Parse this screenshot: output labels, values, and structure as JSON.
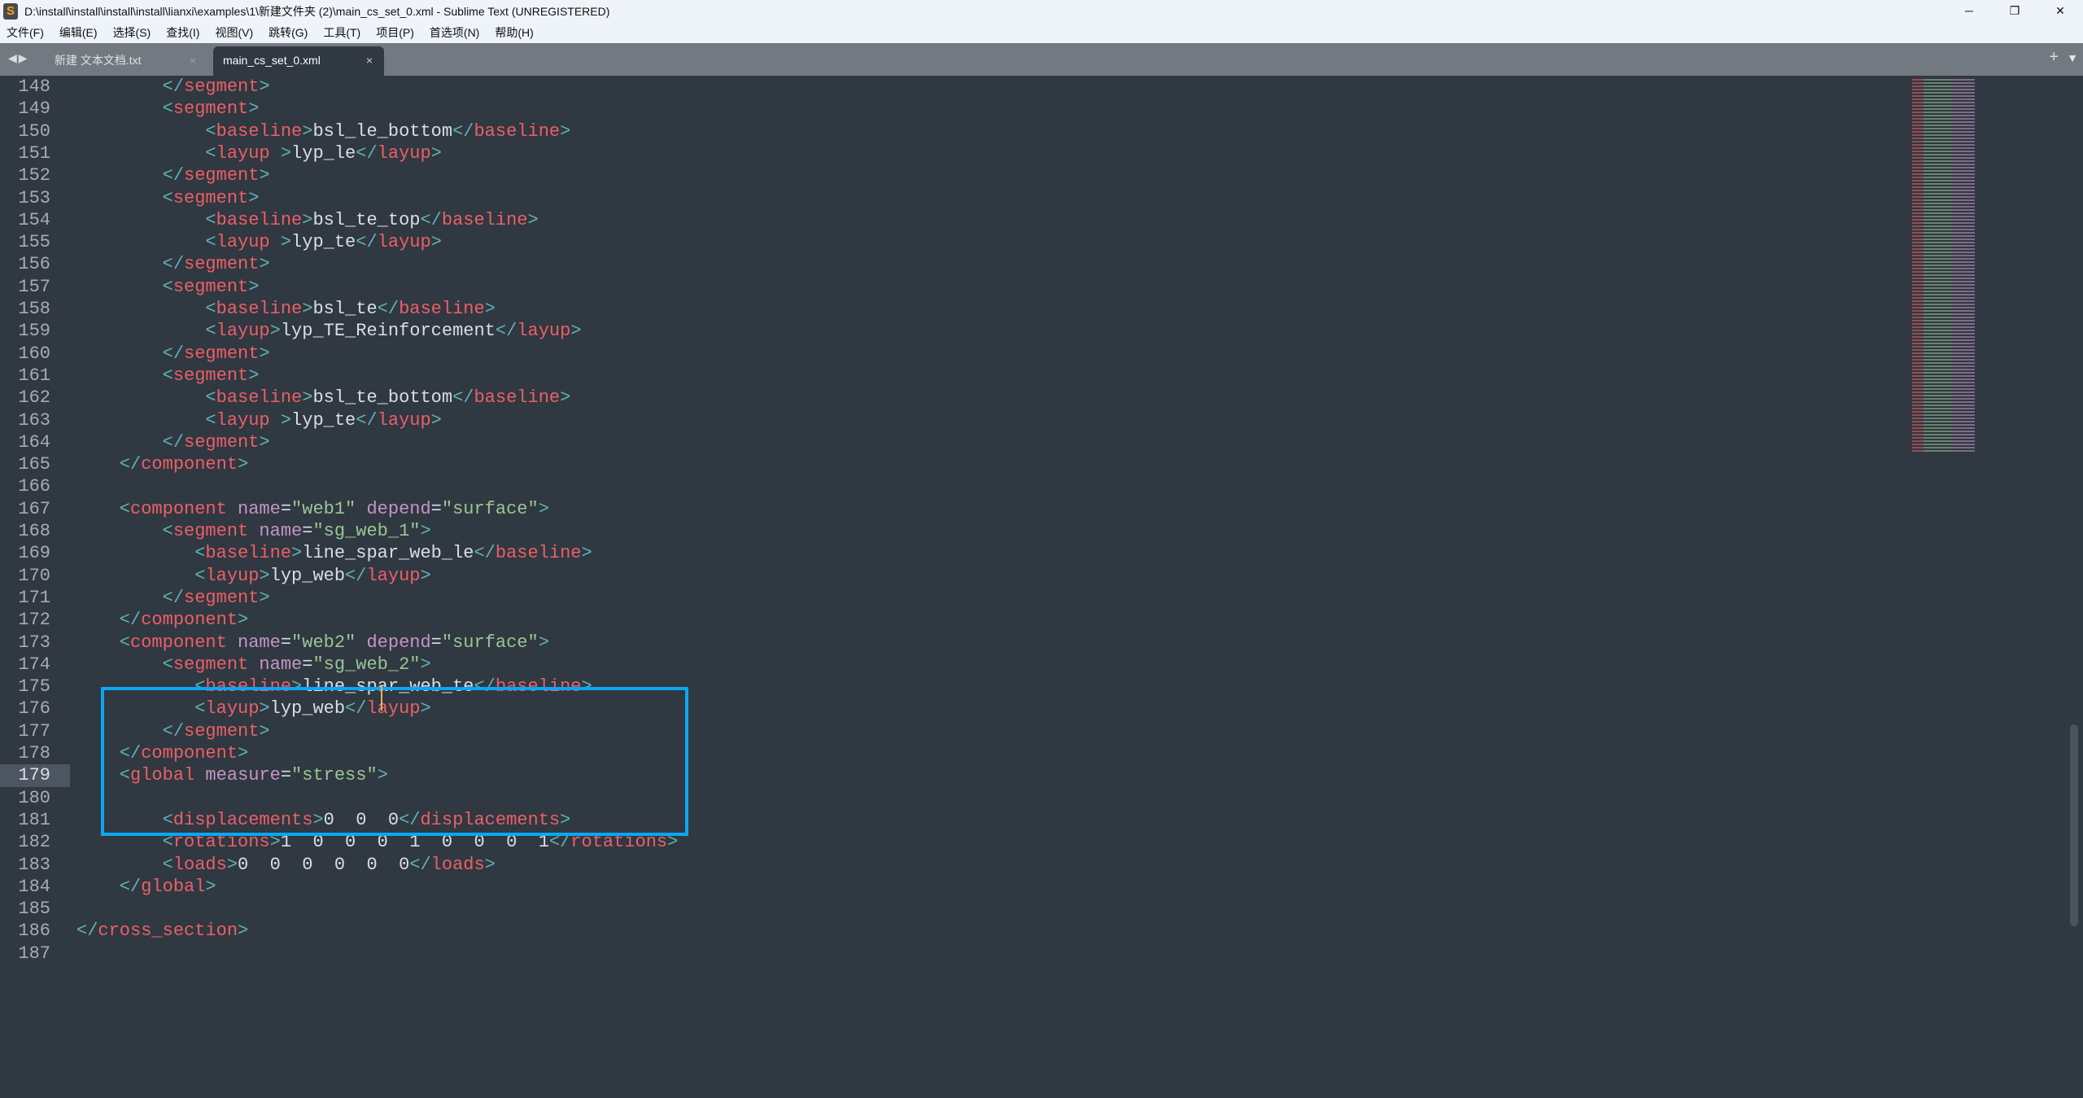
{
  "window": {
    "title": "D:\\install\\install\\install\\install\\lianxi\\examples\\1\\新建文件夹 (2)\\main_cs_set_0.xml - Sublime Text (UNREGISTERED)",
    "minimize": "─",
    "restore": "❐",
    "close": "✕"
  },
  "menu": [
    "文件(F)",
    "编辑(E)",
    "选择(S)",
    "查找(I)",
    "视图(V)",
    "跳转(G)",
    "工具(T)",
    "项目(P)",
    "首选项(N)",
    "帮助(H)"
  ],
  "tabs": [
    {
      "label": "新建 文本文档.txt",
      "close": "×"
    },
    {
      "label": "main_cs_set_0.xml",
      "close": "×",
      "active": true
    }
  ],
  "tabbar": {
    "nav": "◀▶",
    "new_tab": "+",
    "menu": "▼"
  },
  "editor": {
    "current_line": 179,
    "first_line": 148,
    "lines": [
      "        </segment>",
      "        <segment>",
      "            <baseline>bsl_le_bottom</baseline>",
      "            <layup >lyp_le</layup>",
      "        </segment>",
      "        <segment>",
      "            <baseline>bsl_te_top</baseline>",
      "            <layup >lyp_te</layup>",
      "        </segment>",
      "        <segment>",
      "            <baseline>bsl_te</baseline>",
      "            <layup>lyp_TE_Reinforcement</layup>",
      "        </segment>",
      "        <segment>",
      "            <baseline>bsl_te_bottom</baseline>",
      "            <layup >lyp_te</layup>",
      "        </segment>",
      "    </component>",
      "",
      "    <component name=\"web1\" depend=\"surface\">",
      "        <segment name=\"sg_web_1\">",
      "           <baseline>line_spar_web_le</baseline>",
      "           <layup>lyp_web</layup>",
      "        </segment>",
      "    </component>",
      "    <component name=\"web2\" depend=\"surface\">",
      "        <segment name=\"sg_web_2\">",
      "           <baseline>line_spar_web_te</baseline>",
      "           <layup>lyp_web</layup>",
      "        </segment>",
      "    </component>",
      "    <global measure=\"stress\">",
      "",
      "        <displacements>0  0  0</displacements>",
      "        <rotations>1  0  0  0  1  0  0  0  1</rotations>",
      "        <loads>0  0  0  0  0  0</loads>",
      "    </global>",
      "",
      "</cross_section>",
      ""
    ]
  }
}
